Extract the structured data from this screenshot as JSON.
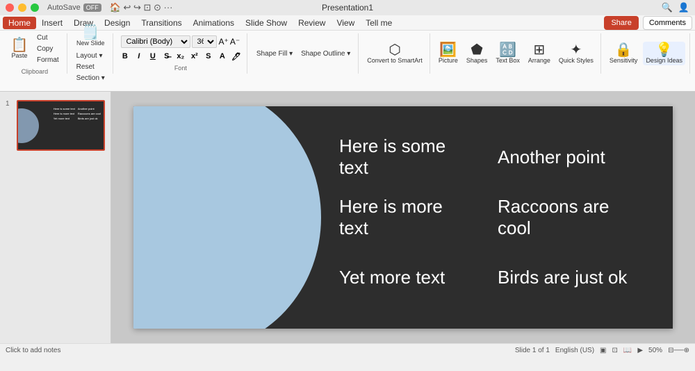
{
  "titleBar": {
    "appName": "AutoSave",
    "autosaveStatus": "OFF",
    "title": "Presentation1",
    "searchPlaceholder": "🔍",
    "shareLabel": "Share",
    "commentsLabel": "Comments"
  },
  "menuBar": {
    "items": [
      "Home",
      "Insert",
      "Draw",
      "Design",
      "Transitions",
      "Animations",
      "Slide Show",
      "Review",
      "View",
      "Tell me"
    ]
  },
  "ribbon": {
    "tabs": [
      "Home",
      "Insert",
      "Draw",
      "Design",
      "Transitions",
      "Animations",
      "Slide Show",
      "Review",
      "View",
      "Tell me"
    ],
    "activeTab": "Home",
    "clipboard": {
      "paste": "Paste",
      "cut": "Cut",
      "copy": "Copy",
      "format": "Format"
    },
    "slides": {
      "new": "New Slide"
    },
    "layout": "Layout ▾",
    "reset": "Reset",
    "section": "Section ▾",
    "font": "Calibri (Body)",
    "fontSize": "36",
    "bold": "B",
    "italic": "I",
    "underline": "U",
    "shape": {
      "fill": "Shape Fill ▾",
      "outline": "Shape Outline ▾"
    },
    "convert": "Convert to SmartArt",
    "picture": "Picture",
    "shapes": "Shapes",
    "textBox": "Text Box",
    "arrange": "Arrange",
    "quickStyles": "Quick Styles",
    "sensitivity": "Sensitivity",
    "designIdeas": "Design Ideas",
    "share": "Share",
    "comments": "Comments"
  },
  "slidePanel": {
    "slideNumber": "1"
  },
  "slide": {
    "cells": [
      {
        "id": "r1c1",
        "text": "Here is some text"
      },
      {
        "id": "r1c2",
        "text": "Another point"
      },
      {
        "id": "r2c1",
        "text": "Here is more text"
      },
      {
        "id": "r2c2",
        "text": "Raccoons are cool"
      },
      {
        "id": "r3c1",
        "text": "Yet more text"
      },
      {
        "id": "r3c2",
        "text": "Birds are just ok"
      }
    ]
  },
  "statusBar": {
    "notes": "Click to add notes",
    "slideInfo": "Slide 1 of 1",
    "language": "English (US)"
  },
  "colors": {
    "accent": "#c8402a",
    "slideBackground": "#2d2d2d",
    "slideCircle": "#a8c8e0",
    "slideText": "#ffffff"
  }
}
